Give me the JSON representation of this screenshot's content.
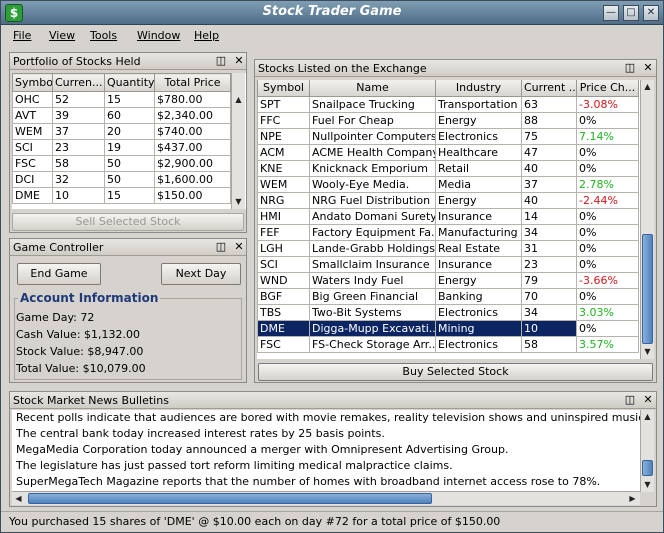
{
  "window": {
    "title": "Stock Trader Game",
    "icon": "dollar-sign-icon"
  },
  "menu": [
    "File",
    "View",
    "Tools",
    "Window",
    "Help"
  ],
  "portfolio": {
    "title": "Portfolio of Stocks Held",
    "columns": [
      "Symbol",
      "Curren...",
      "Quantity",
      "Total Price"
    ],
    "rows": [
      [
        "OHC",
        "52",
        "15",
        "$780.00"
      ],
      [
        "AVT",
        "39",
        "60",
        "$2,340.00"
      ],
      [
        "WEM",
        "37",
        "20",
        "$740.00"
      ],
      [
        "SCI",
        "23",
        "19",
        "$437.00"
      ],
      [
        "FSC",
        "58",
        "50",
        "$2,900.00"
      ],
      [
        "DCI",
        "32",
        "50",
        "$1,600.00"
      ],
      [
        "DME",
        "10",
        "15",
        "$150.00"
      ]
    ],
    "sell_button": "Sell Selected Stock"
  },
  "controller": {
    "title": "Game Controller",
    "end_game": "End Game",
    "next_day": "Next Day",
    "account_heading": "Account Information",
    "game_day": "Game Day: 72",
    "cash_value": "Cash Value: $1,132.00",
    "stock_value": "Stock Value: $8,947.00",
    "total_value": "Total Value: $10,079.00"
  },
  "exchange": {
    "title": "Stocks Listed on the Exchange",
    "columns": [
      "Symbol",
      "Name",
      "Industry",
      "Current ...",
      "Price Ch..."
    ],
    "rows": [
      [
        "SPT",
        "Snailpace Trucking",
        "Transportation",
        "63",
        "-3.08%",
        "neg"
      ],
      [
        "FFC",
        "Fuel For Cheap",
        "Energy",
        "88",
        "0%",
        ""
      ],
      [
        "NPE",
        "Nullpointer Computers",
        "Electronics",
        "75",
        "7.14%",
        "pos"
      ],
      [
        "ACM",
        "ACME Health Company",
        "Healthcare",
        "47",
        "0%",
        ""
      ],
      [
        "KNE",
        "Knicknack Emporium",
        "Retail",
        "40",
        "0%",
        ""
      ],
      [
        "WEM",
        "Wooly-Eye Media.",
        "Media",
        "37",
        "2.78%",
        "pos"
      ],
      [
        "NRG",
        "NRG Fuel Distribution",
        "Energy",
        "40",
        "-2.44%",
        "neg"
      ],
      [
        "HMI",
        "Andato Domani Surety",
        "Insurance",
        "14",
        "0%",
        ""
      ],
      [
        "FEF",
        "Factory Equipment Fa...",
        "Manufacturing",
        "34",
        "0%",
        ""
      ],
      [
        "LGH",
        "Lande-Grabb Holdings",
        "Real Estate",
        "31",
        "0%",
        ""
      ],
      [
        "SCI",
        "Smallclaim Insurance",
        "Insurance",
        "23",
        "0%",
        ""
      ],
      [
        "WND",
        "Waters Indy Fuel",
        "Energy",
        "79",
        "-3.66%",
        "neg"
      ],
      [
        "BGF",
        "Big Green Financial",
        "Banking",
        "70",
        "0%",
        ""
      ],
      [
        "TBS",
        "Two-Bit Systems",
        "Electronics",
        "34",
        "3.03%",
        "pos"
      ],
      [
        "DME",
        "Digga-Mupp Excavati...",
        "Mining",
        "10",
        "0%",
        "selected"
      ],
      [
        "FSC",
        "FS-Check Storage Arr...",
        "Electronics",
        "58",
        "3.57%",
        "pos"
      ]
    ],
    "buy_button": "Buy Selected Stock"
  },
  "news": {
    "title": "Stock Market News Bulletins",
    "lines": [
      "Recent polls indicate that audiences are bored with movie remakes, reality television shows and uninspired music.",
      "The central bank today increased interest rates by 25 basis points.",
      "MegaMedia Corporation today announced a merger with Omnipresent Advertising Group.",
      "The legislature has just passed tort reform limiting medical malpractice claims.",
      "SuperMegaTech Magazine reports that the number of homes with broadband internet access rose to 78%."
    ]
  },
  "status": "You purchased 15 shares of 'DME' @ $10.00 each on day #72 for a total price of $150.00",
  "colors": {
    "selected_row": "#0b2462",
    "positive": "#1fb41f",
    "negative": "#d01818",
    "titlebar": "#5a7890"
  }
}
